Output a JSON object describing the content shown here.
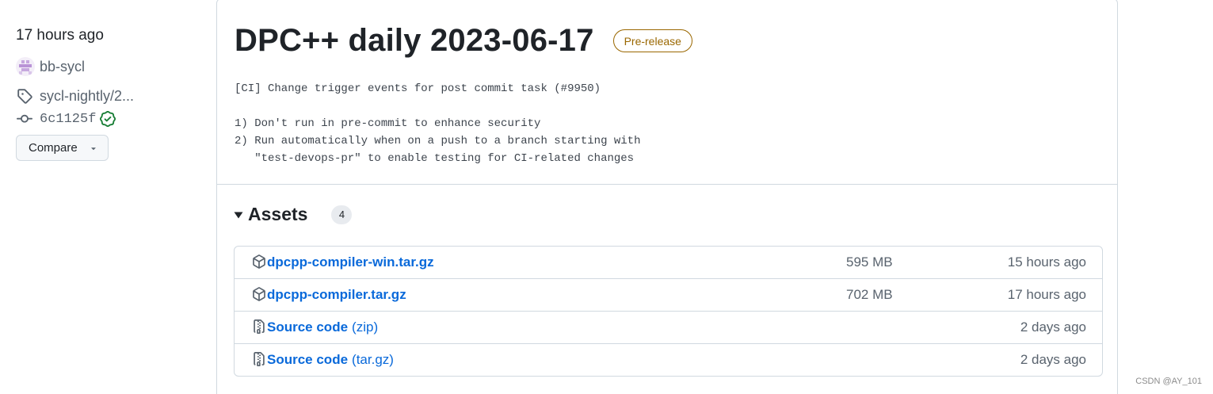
{
  "sidebar": {
    "time": "17 hours ago",
    "author": "bb-sycl",
    "tag": "sycl-nightly/2...",
    "commit": "6c1125f",
    "compare_label": "Compare"
  },
  "release": {
    "title": "DPC++ daily 2023-06-17",
    "badge": "Pre-release",
    "notes": [
      "[CI] Change trigger events for post commit task (#9950)",
      "",
      "1) Don't run in pre-commit to enhance security",
      "2) Run automatically when on a push to a branch starting with",
      "   \"test-devops-pr\" to enable testing for CI-related changes"
    ]
  },
  "assets": {
    "title": "Assets",
    "count": "4",
    "items": [
      {
        "icon": "package-icon",
        "name": "dpcpp-compiler-win.tar.gz",
        "suffix": "",
        "size": "595 MB",
        "date": "15 hours ago"
      },
      {
        "icon": "package-icon",
        "name": "dpcpp-compiler.tar.gz",
        "suffix": "",
        "size": "702 MB",
        "date": "17 hours ago"
      },
      {
        "icon": "file-zip-icon",
        "name": "Source code",
        "suffix": "(zip)",
        "size": "",
        "date": "2 days ago"
      },
      {
        "icon": "file-zip-icon",
        "name": "Source code",
        "suffix": "(tar.gz)",
        "size": "",
        "date": "2 days ago"
      }
    ]
  },
  "watermark": "CSDN @AY_101",
  "colors": {
    "link": "#0969da",
    "prerelease": "#9a6700",
    "success": "#1a7f37",
    "muted": "#59636e",
    "border": "#d1d9e0"
  }
}
